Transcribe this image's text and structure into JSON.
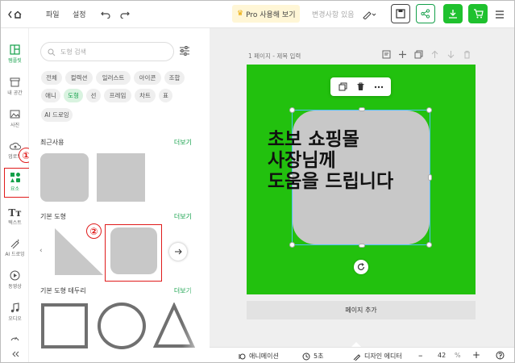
{
  "topbar": {
    "menu_file": "파일",
    "menu_settings": "설정",
    "pro_label": "Pro 사용해 보기",
    "save_status": "변경사항 있음"
  },
  "rail": [
    {
      "label": "템플릿"
    },
    {
      "label": "내 공간"
    },
    {
      "label": "사진"
    },
    {
      "label": "업로드"
    },
    {
      "label": "요소"
    },
    {
      "label": "텍스트"
    },
    {
      "label": "AI 드로잉"
    },
    {
      "label": "동영상"
    },
    {
      "label": "오디오"
    }
  ],
  "panel": {
    "search_placeholder": "도형 검색",
    "chips_row1": [
      "전체",
      "컬렉션",
      "일러스트",
      "아이콘",
      "조합"
    ],
    "chips_row2": [
      "애니",
      "도형",
      "선",
      "프레임",
      "차트",
      "표"
    ],
    "chips_row3": [
      "AI 드로잉"
    ],
    "recent_label": "최근사용",
    "recent_more": "더보기",
    "basic_label": "기본 도형",
    "basic_more": "더보기",
    "border_label": "기본 도형 테두리",
    "border_more": "더보기"
  },
  "canvas": {
    "page_label": "1 페이지 - 제목 입력",
    "headline_lines": [
      "초보 쇼핑몰",
      "사장님께",
      "도움을 드립니다"
    ],
    "add_page": "페이지 추가",
    "bg_color": "#22c10e"
  },
  "annotations": {
    "one": "①",
    "two": "②"
  },
  "bottom": {
    "animation": "애니메이션",
    "duration": "5초",
    "design_editor": "디자인 에디터",
    "zoom": "42",
    "zoom_unit": "%"
  },
  "colors": {
    "accent": "#14a04a",
    "annotation": "#e01b1b",
    "selection": "#4fc3f7"
  }
}
